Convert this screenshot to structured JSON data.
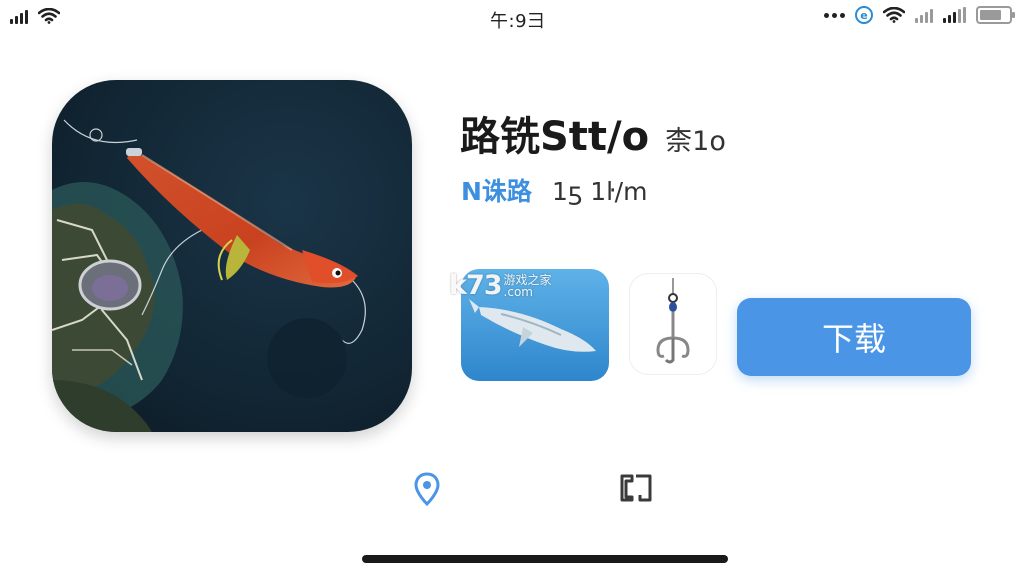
{
  "status_bar": {
    "time": "午:9彐",
    "battery_level": 0.75,
    "icons": [
      "cellular-signal-icon",
      "wifi-icon",
      "more-dots-icon",
      "e-browser-icon",
      "wifi-icon",
      "cellular-signal-icon",
      "cellular-signal-icon",
      "battery-icon"
    ]
  },
  "app": {
    "name": "路铣Stt/o",
    "version": "柰1o",
    "category": "N诛路",
    "size": "1ƽ 1ŀ/m",
    "icon": "fishing-lure-app-icon"
  },
  "screenshots": [
    {
      "label": "shark-screenshot"
    },
    {
      "label": "fishing-hook-screenshot"
    }
  ],
  "watermark": {
    "logo": "k73",
    "line1": "游戏之家",
    "line2": ".com"
  },
  "download_button": {
    "label": "下载"
  },
  "bottom_tabs": [
    {
      "icon": "location-pin-icon"
    },
    {
      "icon": "book-icon"
    }
  ],
  "colors": {
    "accent": "#4a95e6",
    "category_text": "#3d8fe0",
    "background": "#ffffff"
  }
}
